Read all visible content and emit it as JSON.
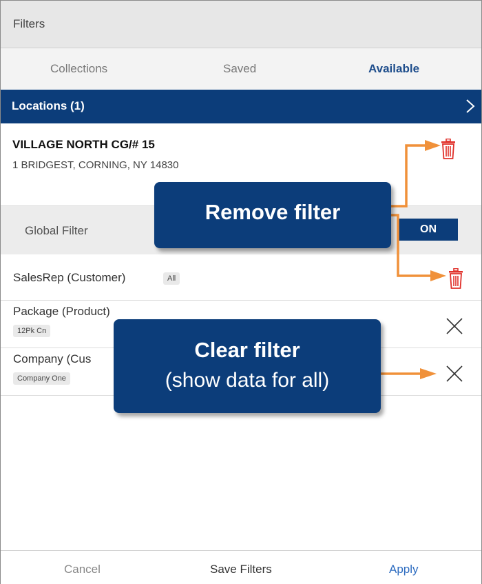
{
  "header": {
    "title": "Filters"
  },
  "tabs": [
    {
      "label": "Collections",
      "active": false
    },
    {
      "label": "Saved",
      "active": false
    },
    {
      "label": "Available",
      "active": true
    }
  ],
  "locations": {
    "title": "Locations (1)",
    "item": {
      "name": "VILLAGE NORTH CG/# 15",
      "address": "1 BRIDGEST, CORNING, NY 14830"
    }
  },
  "global_filter": {
    "label": "Global Filter",
    "toggle": "ON"
  },
  "filters": [
    {
      "label": "SalesRep (Customer)",
      "chip": "All",
      "action": "trash-icon"
    },
    {
      "label": "Package (Product)",
      "chip": "12Pk Cn",
      "action": "close-icon"
    },
    {
      "label": "Company (Cus",
      "chip": "Company One",
      "action": "close-icon"
    }
  ],
  "callouts": {
    "remove": {
      "title": "Remove filter"
    },
    "clear": {
      "title": "Clear filter",
      "subtitle": "(show data for all)"
    }
  },
  "footer": {
    "cancel": "Cancel",
    "save": "Save Filters",
    "apply": "Apply"
  },
  "colors": {
    "brand_navy": "#0c3d7a",
    "tab_active": "#1f4e8c",
    "arrow_orange": "#f0913a",
    "trash_red": "#e0302a",
    "apply_blue": "#2d6cc0"
  }
}
